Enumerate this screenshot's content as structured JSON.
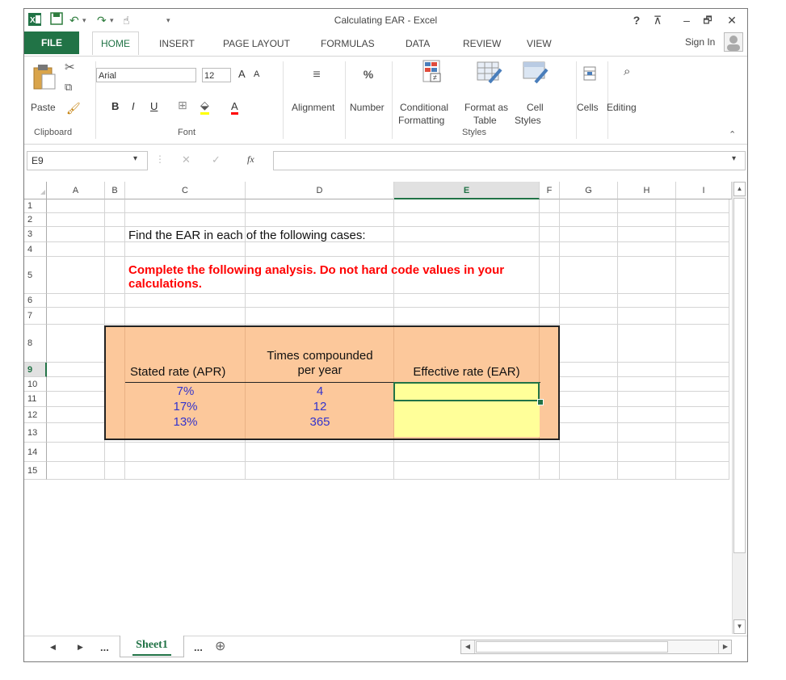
{
  "window": {
    "title": "Calculating EAR - Excel"
  },
  "title_controls": {
    "help": "?",
    "restore_ribbon": "⊼",
    "minimize": "–",
    "maximize": "🗗",
    "close": "✕"
  },
  "tabs": {
    "file": "FILE",
    "home": "HOME",
    "insert": "INSERT",
    "page_layout": "PAGE LAYOUT",
    "formulas": "FORMULAS",
    "data": "DATA",
    "review": "REVIEW",
    "view": "VIEW",
    "sign_in": "Sign In"
  },
  "ribbon": {
    "clipboard": {
      "paste": "Paste",
      "group": "Clipboard"
    },
    "font": {
      "name": "Arial",
      "size": "12",
      "bold": "B",
      "italic": "I",
      "underline": "U",
      "grow": "A",
      "shrink": "A",
      "font_color": "A",
      "group": "Font"
    },
    "alignment": "Alignment",
    "number": {
      "label": "Number",
      "icon_text": "%"
    },
    "styles": {
      "conditional_1": "Conditional",
      "conditional_2": "Formatting",
      "format_table_1": "Format as",
      "format_table_2": "Table",
      "cell_styles_1": "Cell",
      "cell_styles_2": "Styles",
      "group": "Styles"
    },
    "cells": "Cells",
    "editing": "Editing"
  },
  "formula_bar": {
    "name_box": "E9",
    "cancel": "✕",
    "enter": "✓",
    "fx": "fx",
    "value": ""
  },
  "columns": [
    "A",
    "B",
    "C",
    "D",
    "E",
    "F",
    "G",
    "H",
    "I"
  ],
  "rows": [
    "1",
    "2",
    "3",
    "4",
    "5",
    "6",
    "7",
    "8",
    "9",
    "10",
    "11",
    "12",
    "13",
    "14",
    "15"
  ],
  "sheet": {
    "c3": "Find the EAR in each of the following cases:",
    "c5_line1": "Complete the following analysis. Do not hard code values in your",
    "c5_line2": "calculations.",
    "hdr_c": "Stated rate (APR)",
    "hdr_d_line1": "Times compounded",
    "hdr_d_line2": "per year",
    "hdr_e": "Effective rate (EAR)",
    "data": [
      {
        "apr": "7%",
        "times": "4"
      },
      {
        "apr": "17%",
        "times": "12"
      },
      {
        "apr": "13%",
        "times": "365"
      }
    ]
  },
  "sheet_tabs": {
    "active": "Sheet1",
    "more_left": "...",
    "more_right": "...",
    "add": "⊕"
  },
  "colors": {
    "excel_green": "#217346",
    "box_fill": "#fcc89b",
    "input_fill": "#ffff99",
    "red_text": "#ff0000",
    "blue_text": "#3333cc"
  }
}
